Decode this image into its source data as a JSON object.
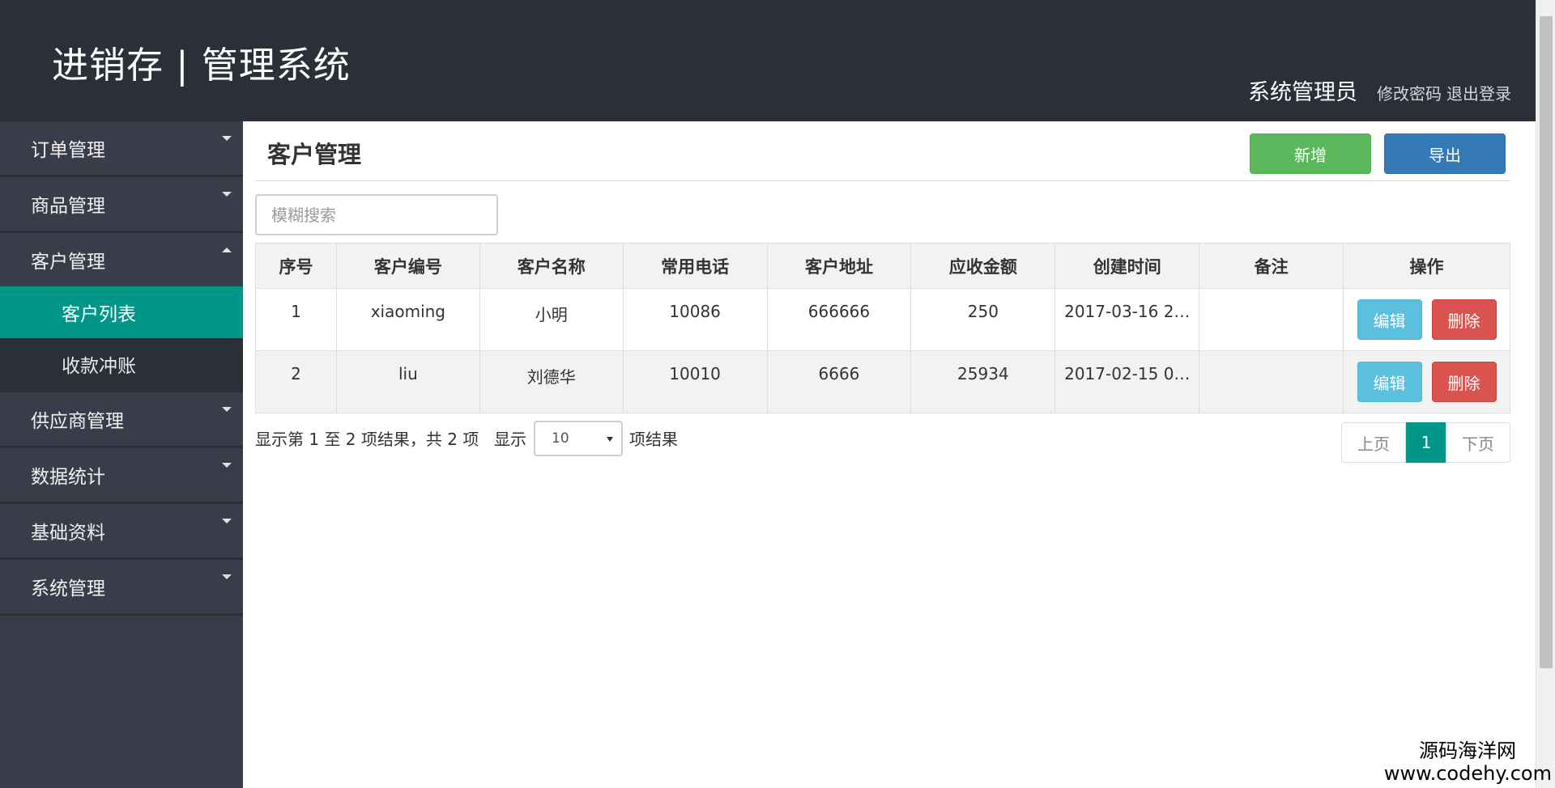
{
  "header": {
    "app_title": "进销存 | 管理系统",
    "user_name": "系统管理员",
    "change_password": "修改密码",
    "logout": "退出登录"
  },
  "sidebar": {
    "groups": [
      {
        "label": "订单管理",
        "expanded": false
      },
      {
        "label": "商品管理",
        "expanded": false
      },
      {
        "label": "客户管理",
        "expanded": true,
        "children": [
          {
            "label": "客户列表",
            "active": true
          },
          {
            "label": "收款冲账",
            "active": false
          }
        ]
      },
      {
        "label": "供应商管理",
        "expanded": false
      },
      {
        "label": "数据统计",
        "expanded": false
      },
      {
        "label": "基础资料",
        "expanded": false
      },
      {
        "label": "系统管理",
        "expanded": false
      }
    ]
  },
  "main": {
    "title": "客户管理",
    "add_label": "新增",
    "export_label": "导出",
    "search_placeholder": "模糊搜索",
    "table": {
      "headers": [
        "序号",
        "客户编号",
        "客户名称",
        "常用电话",
        "客户地址",
        "应收金额",
        "创建时间",
        "备注",
        "操作"
      ],
      "rows": [
        {
          "index": "1",
          "code": "xiaoming",
          "name": "小明",
          "phone": "10086",
          "address": "666666",
          "receivable": "250",
          "created": "2017-03-16 2…",
          "remark": "",
          "edit": "编辑",
          "delete": "删除"
        },
        {
          "index": "2",
          "code": "liu",
          "name": "刘德华",
          "phone": "10010",
          "address": "6666",
          "receivable": "25934",
          "created": "2017-02-15 0…",
          "remark": "",
          "edit": "编辑",
          "delete": "删除"
        }
      ]
    },
    "info_text": "显示第 1 至 2 项结果，共 2 项",
    "length_prefix": "显示",
    "length_value": "10",
    "length_suffix": "项结果",
    "pager": {
      "prev": "上页",
      "current": "1",
      "next": "下页"
    }
  },
  "watermark": {
    "name": "源码海洋网",
    "url": "www.codehy.com"
  },
  "colors": {
    "header_bg": "#2b2f38",
    "sidebar_bg": "#393d49",
    "active": "#009688",
    "add_button": "#5cb85c",
    "export_button": "#337ab7",
    "edit_button": "#5bc0de",
    "delete_button": "#d9534f"
  }
}
